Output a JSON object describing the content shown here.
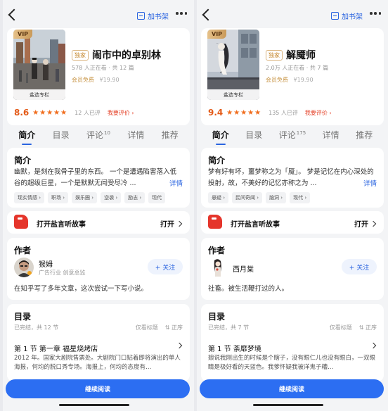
{
  "common": {
    "add_shelf": "加书架",
    "member_free": "会员免费",
    "rate_link": "我要评价 ›",
    "audio_label": "打开盐言听故事",
    "open_label": "打开",
    "section_intro": "简介",
    "section_author": "作者",
    "section_toc": "目录",
    "follow_label": "+ 关注",
    "view_titles": "仅看标题",
    "sort_label": "⇅ 正序",
    "continue_label": "继续阅读",
    "vip_badge": "VIP",
    "exclusive_badge": "独家",
    "cover_tag": "盐选专栏"
  },
  "left": {
    "book_title": "闹市中的卓别林",
    "meta": "578 人正在看 · 共 12 篇",
    "old_price": "¥19.90",
    "score": "8.6",
    "stars": 5,
    "rating_count": "12 人已评",
    "tabs": [
      {
        "label": "简介",
        "count": ""
      },
      {
        "label": "目录",
        "count": ""
      },
      {
        "label": "评论",
        "count": "10"
      },
      {
        "label": "详情",
        "count": ""
      },
      {
        "label": "推荐",
        "count": ""
      }
    ],
    "intro": "幽默，是刻在我骨子里的东西。 一个是遭遇陷害落入低谷的超级巨星，一个是默默无闻受尽冷 ...",
    "intro_more": "详情",
    "tags": [
      "现实情感 ›",
      "职场 ›",
      "娱乐圈 ›",
      "逆袭 ›",
      "励志 ›",
      "现代"
    ],
    "author_name": "猴姆",
    "author_sub": "广告行业 创意总监",
    "author_bio": "在知乎写了多年文章，这次尝试一下写小说。",
    "toc_status": "已完结，共 12 节",
    "chapter_title": "第 1 节 第一章 福星烧烤店",
    "chapter_text": "2012 年。国家大剧院售票处。大剧院门口贴着即将演出的单人海报，何均的脱口秀专场。海报上，何均的态度有…"
  },
  "right": {
    "book_title": "解魇师",
    "meta": "2.0万 人正在看 · 共 7 篇",
    "old_price": "¥19.90",
    "score": "9.4",
    "stars": 5,
    "rating_count": "135 人已评",
    "tabs": [
      {
        "label": "简介",
        "count": ""
      },
      {
        "label": "目录",
        "count": ""
      },
      {
        "label": "评论",
        "count": "175"
      },
      {
        "label": "详情",
        "count": ""
      },
      {
        "label": "推荐",
        "count": ""
      }
    ],
    "intro": "梦有好有坏，噩梦称之为「魇」。 梦是记忆在内心深处的投射，故，不美好的记忆亦称之为 ...",
    "intro_more": "详情",
    "tags": [
      "悬疑 ›",
      "民间奇闻 ›",
      "脑洞 ›",
      "现代 ›"
    ],
    "author_name": "西月棠",
    "author_sub": "",
    "author_bio": "社畜。被生活鞭打过的人。",
    "toc_status": "已完结，共 7 节",
    "chapter_title": "第 1 节 荼靡梦境",
    "chapter_text": "娘说我刚出生的时候是个瞎子，没有眼仁儿也没有眼白，一双眼睛是极好看的天蓝色。我爹怀疑我被洋鬼子糟…"
  }
}
